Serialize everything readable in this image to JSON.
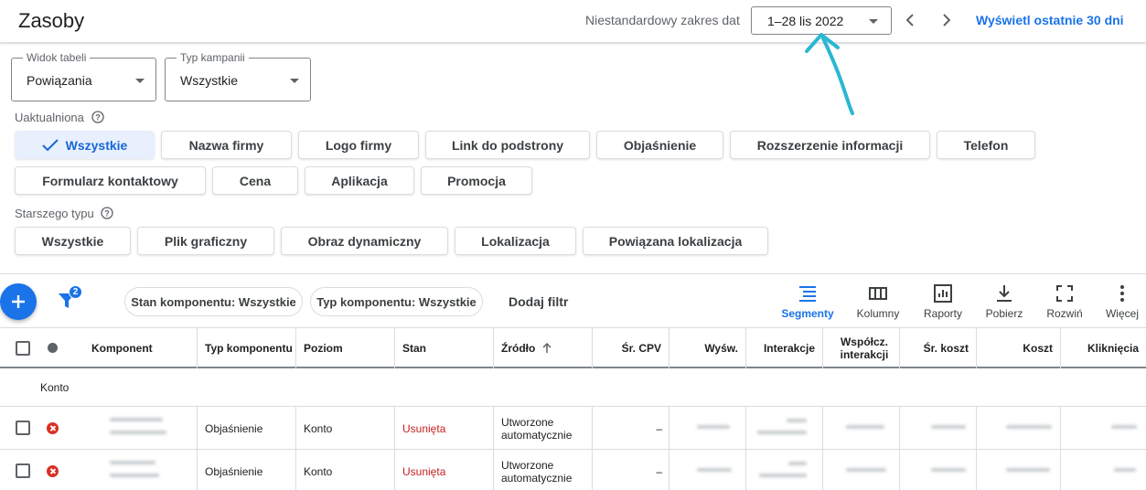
{
  "header": {
    "title": "Zasoby",
    "date_range_label": "Niestandardowy zakres dat",
    "date_range_value": "1–28 lis 2022",
    "last_30_days": "Wyświetl ostatnie 30 dni",
    "accent_color": "#1a73e8",
    "prev_icon": "chevron-left-icon",
    "next_icon": "chevron-right-icon"
  },
  "selects": {
    "table_view": {
      "label": "Widok tabeli",
      "value": "Powiązania"
    },
    "campaign_type": {
      "label": "Typ kampanii",
      "value": "Wszystkie"
    }
  },
  "upgraded": {
    "label": "Uaktualniona",
    "chips": [
      "Wszystkie",
      "Nazwa firmy",
      "Logo firmy",
      "Link do podstrony",
      "Objaśnienie",
      "Rozszerzenie informacji",
      "Telefon",
      "Formularz kontaktowy",
      "Cena",
      "Aplikacja",
      "Promocja"
    ],
    "selected": "Wszystkie"
  },
  "legacy": {
    "label": "Starszego typu",
    "chips": [
      "Wszystkie",
      "Plik graficzny",
      "Obraz dynamiczny",
      "Lokalizacja",
      "Powiązana lokalizacja"
    ]
  },
  "toolbar": {
    "filter_count": "2",
    "filter_chips": [
      "Stan komponentu: Wszystkie",
      "Typ komponentu: Wszystkie"
    ],
    "add_filter": "Dodaj filtr",
    "tools": [
      {
        "label": "Segmenty",
        "icon": "segments-icon",
        "active": true
      },
      {
        "label": "Kolumny",
        "icon": "columns-icon"
      },
      {
        "label": "Raporty",
        "icon": "reports-icon"
      },
      {
        "label": "Pobierz",
        "icon": "download-icon"
      },
      {
        "label": "Rozwiń",
        "icon": "expand-icon"
      },
      {
        "label": "Więcej",
        "icon": "more-vert-icon"
      }
    ]
  },
  "table": {
    "columns": [
      "Komponent",
      "Typ komponentu",
      "Poziom",
      "Stan",
      "Źródło",
      "Śr. CPV",
      "Wyśw.",
      "Interakcje",
      "Współcz. interakcji",
      "Śr. koszt",
      "Koszt",
      "Kliknięcia"
    ],
    "group_label": "Konto",
    "rows": [
      {
        "type": "Objaśnienie",
        "level": "Konto",
        "status": "Usunięta",
        "source": "Utworzone automatycznie",
        "cpv": "–"
      },
      {
        "type": "Objaśnienie",
        "level": "Konto",
        "status": "Usunięta",
        "source": "Utworzone automatycznie",
        "cpv": "–"
      }
    ],
    "status_color": "#c5221f"
  }
}
